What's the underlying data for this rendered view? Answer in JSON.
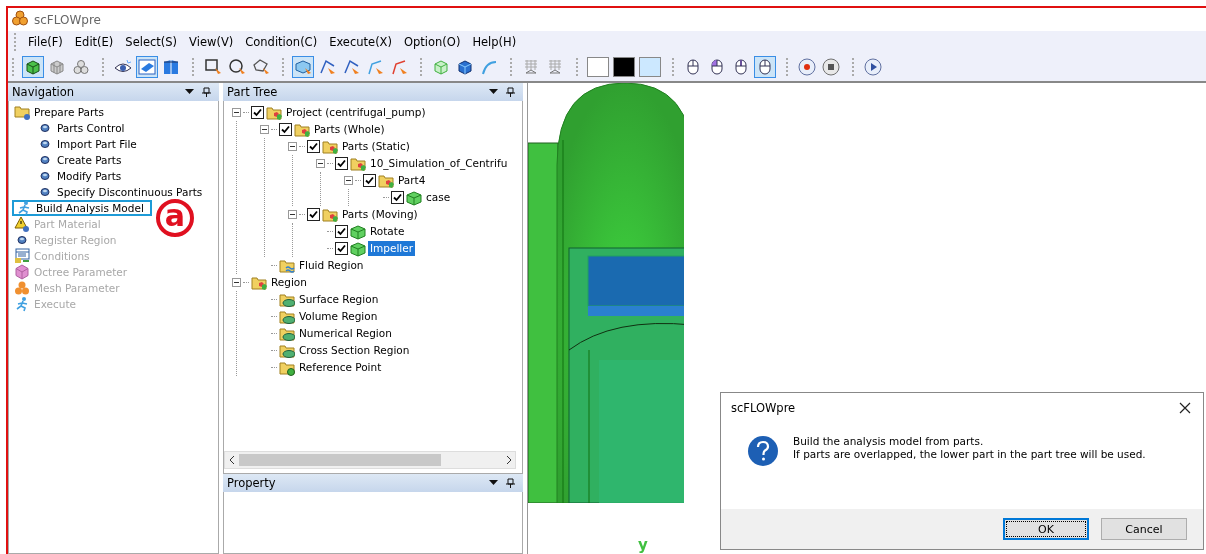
{
  "window": {
    "title": "scFLOWpre"
  },
  "menu": [
    {
      "label": "File(F)"
    },
    {
      "label": "Edit(E)"
    },
    {
      "label": "Select(S)"
    },
    {
      "label": "View(V)"
    },
    {
      "label": "Condition(C)"
    },
    {
      "label": "Execute(X)"
    },
    {
      "label": "Option(O)"
    },
    {
      "label": "Help(H)"
    }
  ],
  "toolbar": [
    [
      {
        "kind": "cube-green",
        "selected": true
      },
      {
        "kind": "cube-grey",
        "selected": false
      },
      {
        "kind": "spheres",
        "selected": false
      }
    ],
    [
      {
        "kind": "eye",
        "selected": false
      },
      {
        "kind": "plane",
        "selected": true
      },
      {
        "kind": "box-view",
        "selected": false
      }
    ],
    [
      {
        "kind": "select-rect",
        "selected": false
      },
      {
        "kind": "select-circle",
        "selected": false
      },
      {
        "kind": "select-polygon",
        "selected": false
      }
    ],
    [
      {
        "kind": "select-cube",
        "selected": true
      },
      {
        "kind": "pick-face",
        "selected": false
      },
      {
        "kind": "pick-face",
        "selected": false
      },
      {
        "kind": "pick-edge",
        "selected": false
      },
      {
        "kind": "pick-edge-red",
        "selected": false
      }
    ],
    [
      {
        "kind": "cube-outline",
        "selected": false
      },
      {
        "kind": "cube-blue",
        "selected": false
      },
      {
        "kind": "curve",
        "selected": false
      }
    ],
    [
      {
        "kind": "grid",
        "selected": false
      },
      {
        "kind": "grid",
        "selected": false
      }
    ],
    [
      {
        "kind": "swatch",
        "color": "#ffffff",
        "selected": false
      },
      {
        "kind": "swatch",
        "color": "#000000",
        "selected": false
      },
      {
        "kind": "swatch",
        "color": "#cce8ff",
        "selected": false
      }
    ],
    [
      {
        "kind": "mouse",
        "selected": false
      },
      {
        "kind": "mouse-left",
        "selected": false
      },
      {
        "kind": "mouse-middle",
        "selected": false
      },
      {
        "kind": "mouse",
        "selected": true
      }
    ],
    [
      {
        "kind": "record",
        "selected": false
      },
      {
        "kind": "stop",
        "selected": false
      }
    ],
    [
      {
        "kind": "play",
        "selected": false
      }
    ]
  ],
  "navigation": {
    "title": "Navigation",
    "items": [
      {
        "label": "Prepare Parts",
        "kind": "folder",
        "disabled": false,
        "highlighted": false,
        "children": [
          {
            "label": "Parts Control",
            "kind": "dot",
            "disabled": false,
            "highlighted": false
          },
          {
            "label": "Import Part File",
            "kind": "dot",
            "disabled": false,
            "highlighted": false
          },
          {
            "label": "Create Parts",
            "kind": "dot",
            "disabled": false,
            "highlighted": false
          },
          {
            "label": "Modify Parts",
            "kind": "dot",
            "disabled": false,
            "highlighted": false
          },
          {
            "label": "Specify Discontinuous Parts",
            "kind": "dot",
            "disabled": false,
            "highlighted": false
          }
        ]
      },
      {
        "label": "Build Analysis Model",
        "kind": "runner",
        "disabled": false,
        "highlighted": true,
        "annotation": "a"
      },
      {
        "label": "Part Material",
        "kind": "warning",
        "disabled": true,
        "highlighted": false
      },
      {
        "label": "Register Region",
        "kind": "dot",
        "disabled": true,
        "highlighted": false
      },
      {
        "label": "Conditions",
        "kind": "form",
        "disabled": true,
        "highlighted": false
      },
      {
        "label": "Octree Parameter",
        "kind": "octree",
        "disabled": true,
        "highlighted": false
      },
      {
        "label": "Mesh Parameter",
        "kind": "spheres",
        "disabled": true,
        "highlighted": false
      },
      {
        "label": "Execute",
        "kind": "runner",
        "disabled": true,
        "highlighted": false
      }
    ]
  },
  "part_tree": {
    "title": "Part Tree",
    "items": [
      {
        "label": "Project (centrifugal_pump)",
        "kind": "parts-folder",
        "checked": true,
        "expanded": true,
        "selected": false,
        "children": [
          {
            "label": "Parts (Whole)",
            "kind": "parts-folder",
            "checked": true,
            "expanded": true,
            "selected": false,
            "children": [
              {
                "label": "Parts (Static)",
                "kind": "parts-folder",
                "checked": true,
                "expanded": true,
                "selected": false,
                "children": [
                  {
                    "label": "10_Simulation_of_Centrifu",
                    "kind": "parts-folder",
                    "checked": true,
                    "expanded": true,
                    "selected": false,
                    "children": [
                      {
                        "label": "Part4",
                        "kind": "parts-folder",
                        "checked": true,
                        "expanded": true,
                        "selected": false,
                        "children": [
                          {
                            "label": "case",
                            "kind": "part",
                            "checked": true,
                            "selected": false
                          }
                        ]
                      }
                    ]
                  }
                ]
              },
              {
                "label": "Parts (Moving)",
                "kind": "parts-folder",
                "checked": true,
                "expanded": true,
                "selected": false,
                "children": [
                  {
                    "label": "Rotate",
                    "kind": "part",
                    "checked": true,
                    "selected": false
                  },
                  {
                    "label": "Impeller",
                    "kind": "part",
                    "checked": true,
                    "selected": true
                  }
                ]
              }
            ]
          },
          {
            "label": "Fluid Region",
            "kind": "fluid-folder",
            "selected": false
          }
        ]
      },
      {
        "label": "Region",
        "kind": "parts-folder",
        "expanded": true,
        "selected": false,
        "children": [
          {
            "label": "Surface Region",
            "kind": "region-folder",
            "selected": false
          },
          {
            "label": "Volume Region",
            "kind": "region-folder",
            "selected": false
          },
          {
            "label": "Numerical Region",
            "kind": "region-folder",
            "selected": false
          },
          {
            "label": "Cross Section Region",
            "kind": "region-folder",
            "selected": false
          },
          {
            "label": "Reference Point",
            "kind": "point-folder",
            "selected": false
          }
        ]
      }
    ]
  },
  "property": {
    "title": "Property"
  },
  "viewport": {
    "kind": "picture",
    "axis_label": "y"
  },
  "dialog": {
    "title": "scFLOWpre",
    "message": [
      "Build the analysis model from parts.",
      "If parts are overlapped, the lower part in the part tree will be used."
    ],
    "buttons": [
      {
        "label": "OK",
        "default": true
      },
      {
        "label": "Cancel",
        "default": false
      }
    ]
  }
}
